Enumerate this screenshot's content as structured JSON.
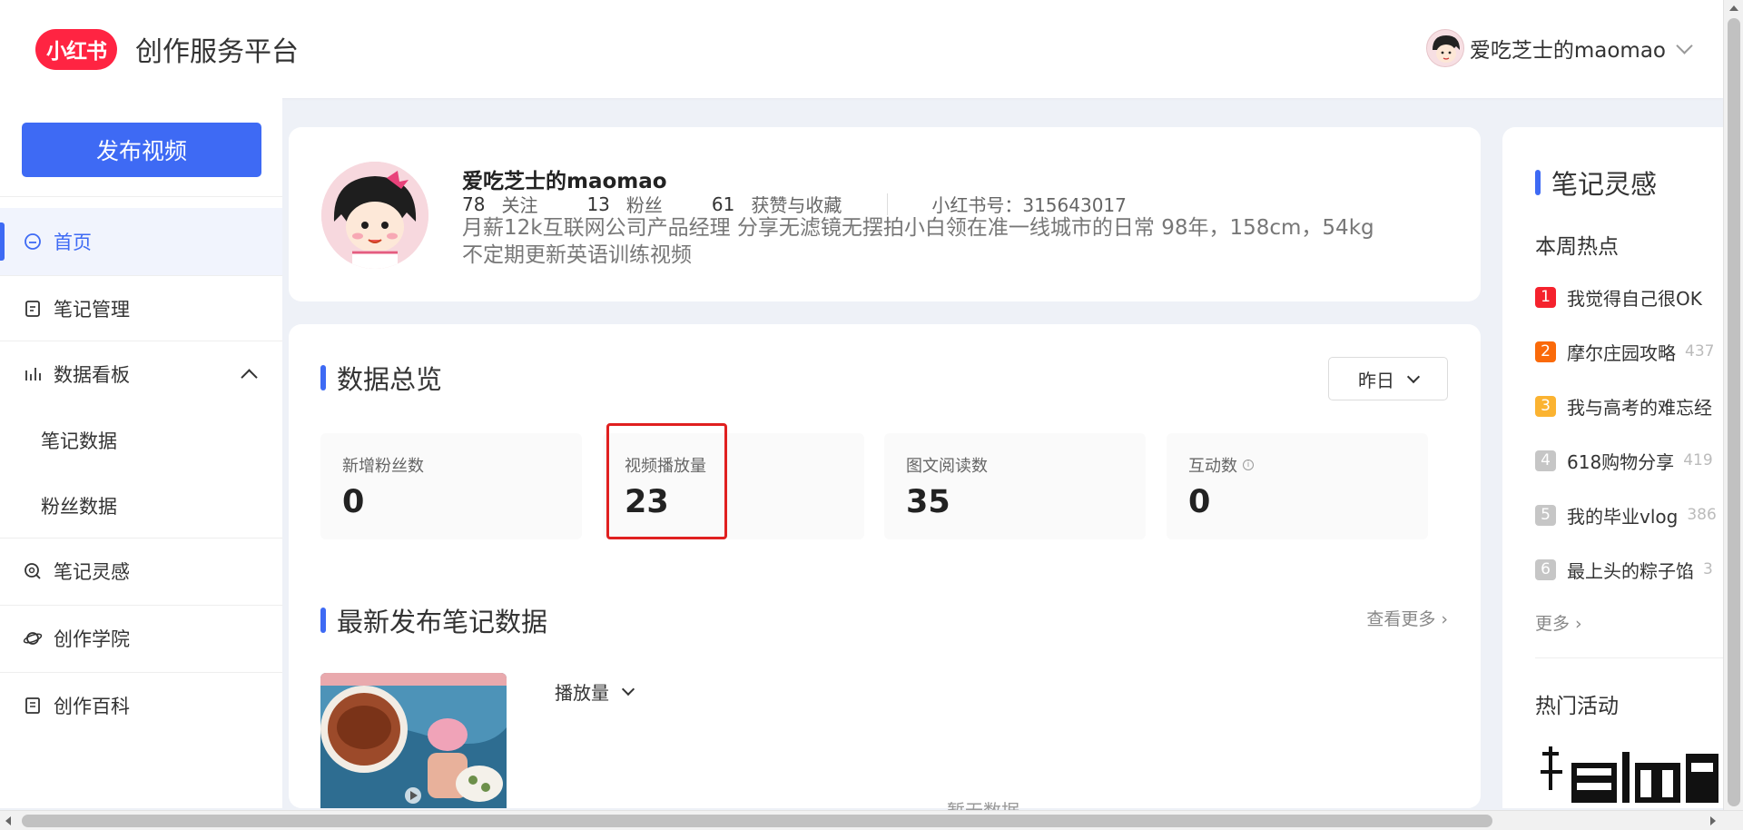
{
  "header": {
    "logo_text": "小红书",
    "brand": "创作服务平台",
    "user_name": "爱吃芝士的maomao"
  },
  "sidebar": {
    "publish_label": "发布视频",
    "items": [
      {
        "label": "首页",
        "icon": "home-icon",
        "active": true
      },
      {
        "label": "笔记管理",
        "icon": "note-icon"
      },
      {
        "label": "数据看板",
        "icon": "chart-icon",
        "expanded": true
      },
      {
        "label": "笔记数据",
        "sub": true
      },
      {
        "label": "粉丝数据",
        "sub": true
      },
      {
        "label": "笔记灵感",
        "icon": "bulb-icon"
      },
      {
        "label": "创作学院",
        "icon": "planet-icon"
      },
      {
        "label": "创作百科",
        "icon": "book-icon"
      }
    ]
  },
  "profile": {
    "name": "爱吃芝士的maomao",
    "following_count": "78",
    "following_label": "关注",
    "fans_count": "13",
    "fans_label": "粉丝",
    "likes_count": "61",
    "likes_label": "获赞与收藏",
    "id_text": "小红书号：315643017",
    "bio_line1": "月薪12k互联网公司产品经理 分享无滤镜无摆拍小白领在准一线城市的日常 98年，158cm，54kg",
    "bio_line2": "不定期更新英语训练视频"
  },
  "overview": {
    "title": "数据总览",
    "period": "昨日",
    "stats": [
      {
        "label": "新增粉丝数",
        "value": "0"
      },
      {
        "label": "视频播放量",
        "value": "23",
        "highlighted": true
      },
      {
        "label": "图文阅读数",
        "value": "35"
      },
      {
        "label": "互动数",
        "value": "0",
        "info": true
      }
    ],
    "latest_title": "最新发布笔记数据",
    "see_more": "查看更多 ›",
    "metric": "播放量",
    "no_data": "暂无数据"
  },
  "inspiration": {
    "title": "笔记灵感",
    "hot_subtitle": "本周热点",
    "hot_items": [
      {
        "rank": "1",
        "text": "我觉得自己很OK",
        "count": "",
        "color": "#f5222d"
      },
      {
        "rank": "2",
        "text": "摩尔庄园攻略",
        "count": "437",
        "color": "#fa6a0a"
      },
      {
        "rank": "3",
        "text": "我与高考的难忘经",
        "count": "",
        "color": "#fbb331"
      },
      {
        "rank": "4",
        "text": "618购物分享",
        "count": "419",
        "color": "#c6c6c6"
      },
      {
        "rank": "5",
        "text": "我的毕业vlog",
        "count": "386",
        "color": "#c6c6c6"
      },
      {
        "rank": "6",
        "text": "最上头的粽子馅",
        "count": "3",
        "color": "#c6c6c6"
      }
    ],
    "more": "更多 ›",
    "events_title": "热门活动"
  },
  "colors": {
    "accent": "#3e6af4",
    "brand_red": "#ff2442",
    "highlight_red": "#e02020"
  }
}
